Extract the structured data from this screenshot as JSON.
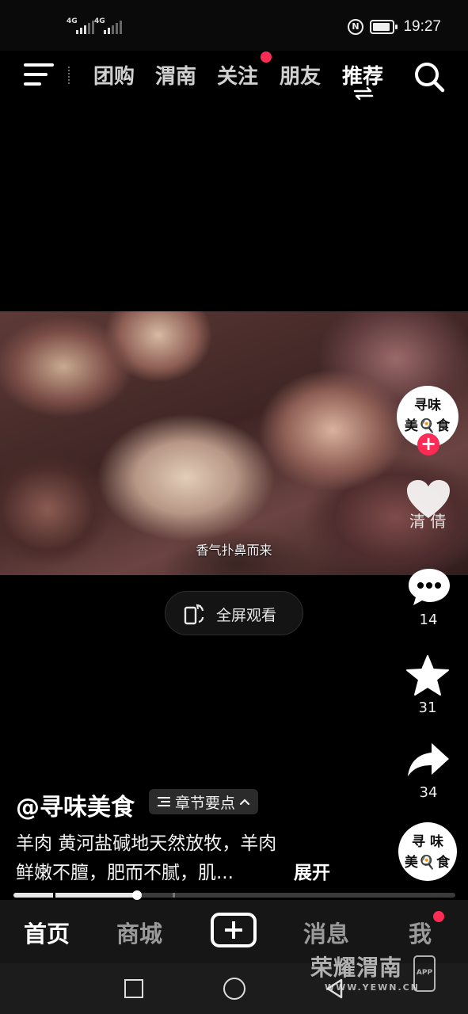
{
  "status_bar": {
    "signal1": "4G",
    "signal2": "4G",
    "time": "19:27",
    "icons": [
      "signal-icon",
      "signal-icon",
      "nfc-icon",
      "battery-icon"
    ]
  },
  "top_nav": {
    "tabs": [
      {
        "label": "团购",
        "active": false
      },
      {
        "label": "渭南",
        "active": false
      },
      {
        "label": "关注",
        "active": false,
        "badge": true
      },
      {
        "label": "朋友",
        "active": false
      },
      {
        "label": "推荐",
        "active": true
      }
    ],
    "icons": [
      "menu-icon",
      "swap-icon",
      "search-icon"
    ]
  },
  "video": {
    "caption": "香气扑鼻而来"
  },
  "fullscreen": {
    "label": "全屏观看"
  },
  "rail": {
    "avatar_line1": "寻味",
    "avatar_line2": "美🍳食",
    "heart_overlay": "清 倩",
    "comments": "14",
    "favorites": "31",
    "shares": "34",
    "music_line1": "寻 味",
    "music_line2": "美🍳食"
  },
  "post": {
    "author": "@寻味美食",
    "chapters_label": "章节要点",
    "desc_line1": "羊肉 黄河盐碱地天然放牧，羊肉",
    "desc_line2": "鲜嫩不膻，肥而不腻，肌...",
    "expand": "展开",
    "progress": 0.28
  },
  "bottom_tabs": [
    {
      "label": "首页",
      "active": true
    },
    {
      "label": "商城",
      "active": false
    },
    {
      "label": "消息",
      "active": false
    },
    {
      "label": "我",
      "active": false,
      "badge": true
    }
  ],
  "watermark": {
    "title": "荣耀渭南",
    "url": "WWW.YEWN.CN",
    "app": "APP"
  },
  "colors": {
    "accent": "#fe2c55",
    "background": "#000000",
    "tabbar": "#161616"
  }
}
